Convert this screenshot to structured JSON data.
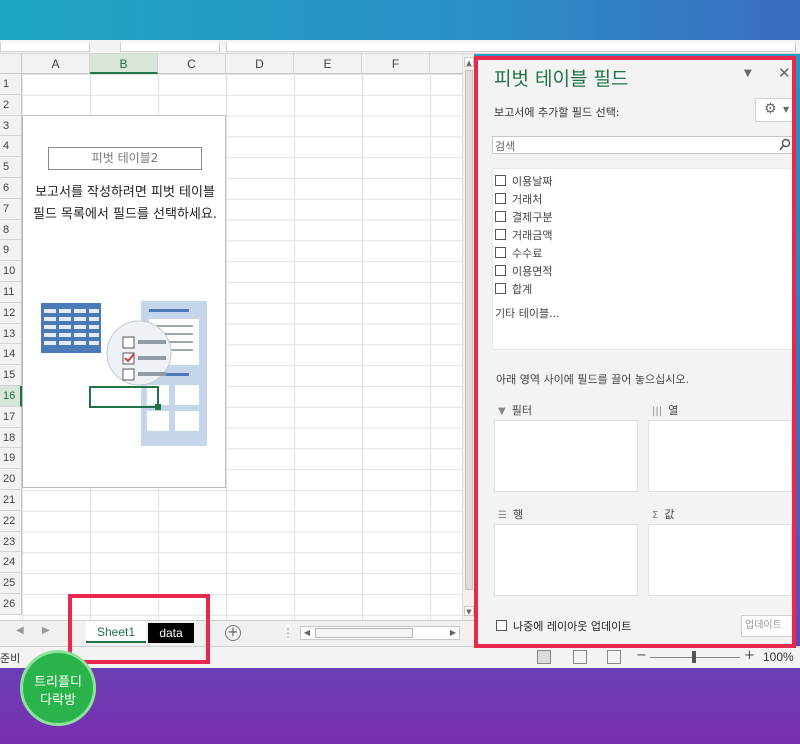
{
  "columns": [
    "A",
    "B",
    "C",
    "D",
    "E",
    "F"
  ],
  "selected_column": "B",
  "rows": [
    "1",
    "2",
    "3",
    "4",
    "5",
    "6",
    "7",
    "8",
    "9",
    "10",
    "11",
    "12",
    "13",
    "14",
    "15",
    "16",
    "17",
    "18",
    "19",
    "20",
    "21",
    "22",
    "23",
    "24",
    "25",
    "26"
  ],
  "selected_row": "16",
  "pivot_placeholder": {
    "name": "피벗 테이블2",
    "message": "보고서를 작성하려면 피벗 테이블 필드 목록에서 필드를 선택하세요."
  },
  "sheet_tabs": [
    "Sheet1",
    "data"
  ],
  "active_tab": "Sheet1",
  "status": {
    "mode": "준비",
    "zoom": "100%"
  },
  "pane": {
    "title": "피벗 테이블 필드",
    "subtitle": "보고서에 추가할 필드 선택:",
    "search_placeholder": "검색",
    "fields": [
      "이용날짜",
      "거래처",
      "결제구분",
      "거래금액",
      "수수료",
      "이용면적",
      "합계"
    ],
    "more_tables": "기타 테이블...",
    "drag_instruction": "아래 영역 사이에 필드를 끌어 놓으십시오.",
    "areas": {
      "filter": "필터",
      "columns": "열",
      "rows": "행",
      "values": "값"
    },
    "defer_update": "나중에 레이아웃 업데이트",
    "update_button": "업데이트"
  },
  "logo": {
    "line1": "트리플디",
    "line2": "다락방"
  },
  "colors": {
    "accent_green": "#217346",
    "highlight_red": "#e8284d"
  }
}
